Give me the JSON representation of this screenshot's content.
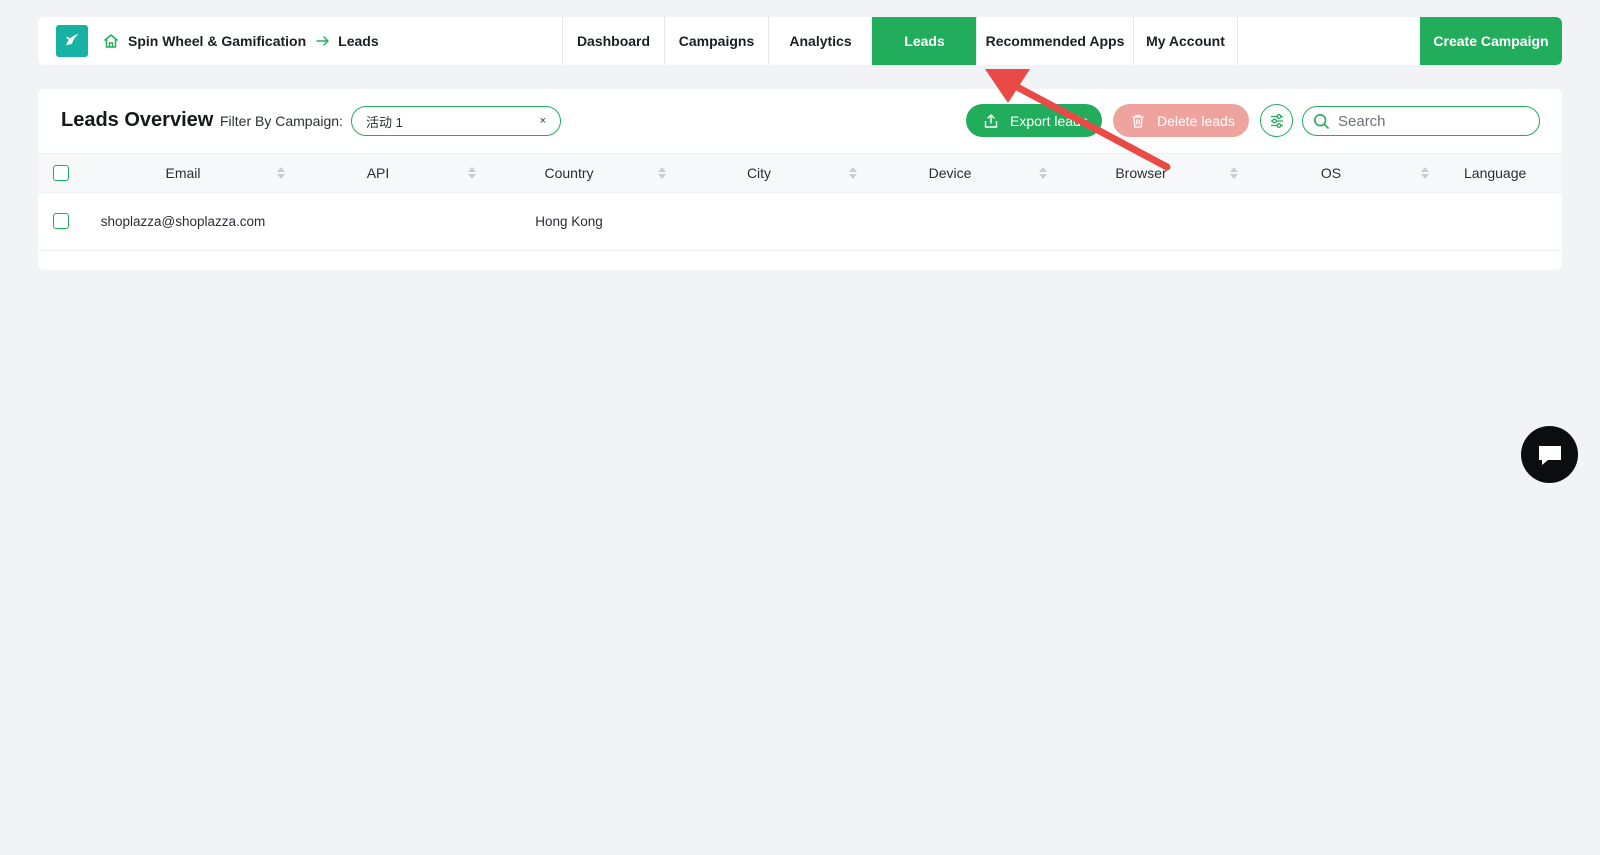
{
  "colors": {
    "accent": "#22ad5c",
    "danger_soft": "#eea39e",
    "background": "#f1f3f6",
    "annotation": "#ea4a45"
  },
  "header": {
    "breadcrumb": {
      "app": "Spin Wheel & Gamification",
      "current": "Leads"
    },
    "nav": [
      {
        "label": "Dashboard",
        "active": false
      },
      {
        "label": "Campaigns",
        "active": false
      },
      {
        "label": "Analytics",
        "active": false
      },
      {
        "label": "Leads",
        "active": true
      },
      {
        "label": "Recommended Apps",
        "active": false
      },
      {
        "label": "My Account",
        "active": false
      }
    ],
    "create_button": "Create Campaign"
  },
  "leads": {
    "title": "Leads Overview",
    "filter_label": "Filter By Campaign:",
    "filter_value": "活动 1",
    "filter_clear": "×",
    "export_button": "Export leads",
    "delete_button": "Delete leads",
    "search_placeholder": "Search",
    "columns": [
      "Email",
      "API",
      "Country",
      "City",
      "Device",
      "Browser",
      "OS",
      "Language"
    ],
    "rows": [
      {
        "Email": "shoplazza@shoplazza.com",
        "API": "",
        "Country": "Hong Kong",
        "City": "",
        "Device": "",
        "Browser": "",
        "OS": "",
        "Language": ""
      }
    ]
  },
  "icons": [
    "app-logo-icon",
    "home-icon",
    "breadcrumb-arrow-icon",
    "upload-icon",
    "trash-icon",
    "sliders-icon",
    "search-icon",
    "sort-icon",
    "chat-icon"
  ]
}
